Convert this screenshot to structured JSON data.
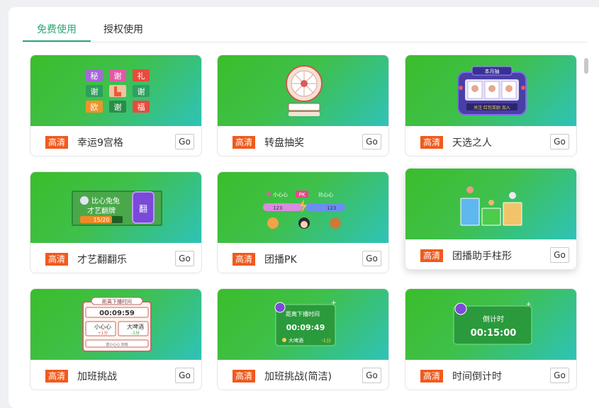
{
  "tabs": [
    {
      "label": "免费使用",
      "active": true
    },
    {
      "label": "授权使用",
      "active": false
    }
  ],
  "badge_label": "高清",
  "go_label": "Go",
  "cards": [
    {
      "title": "幸运9宫格",
      "grid_chars": [
        "秘",
        "谢",
        "礼",
        "谢",
        "",
        "谢",
        "欧",
        "谢",
        "福"
      ]
    },
    {
      "title": "转盘抽奖"
    },
    {
      "title": "天选之人",
      "banner": "本月抽",
      "footer": "关注 红包奖励 加入"
    },
    {
      "title": "才艺翻翻乐",
      "line1": "比心兔兔",
      "line2": "才艺翻牌",
      "progress": "15/20",
      "flip": "翻"
    },
    {
      "title": "团播PK",
      "left_tag": "小心心",
      "mid_tag": "PK",
      "right_tag": "比心心",
      "left_score": "123",
      "right_score": "123"
    },
    {
      "title": "团播助手柱形"
    },
    {
      "title": "加班挑战",
      "header": "距离下播时间",
      "time": "00:09:59",
      "item1": "小心心",
      "item1_sub": "+1分",
      "item2": "大啤酒",
      "item2_sub": "-1分",
      "footer": "送小心心 加班"
    },
    {
      "title": "加班挑战(简洁)",
      "header": "距离下播时间",
      "time": "00:09:49",
      "item": "大啤酒",
      "delta": "-1分"
    },
    {
      "title": "时间倒计时",
      "header": "倒计时",
      "time": "00:15:00"
    }
  ],
  "colors": {
    "accent": "#2aa876",
    "badge": "#f05a1d"
  }
}
